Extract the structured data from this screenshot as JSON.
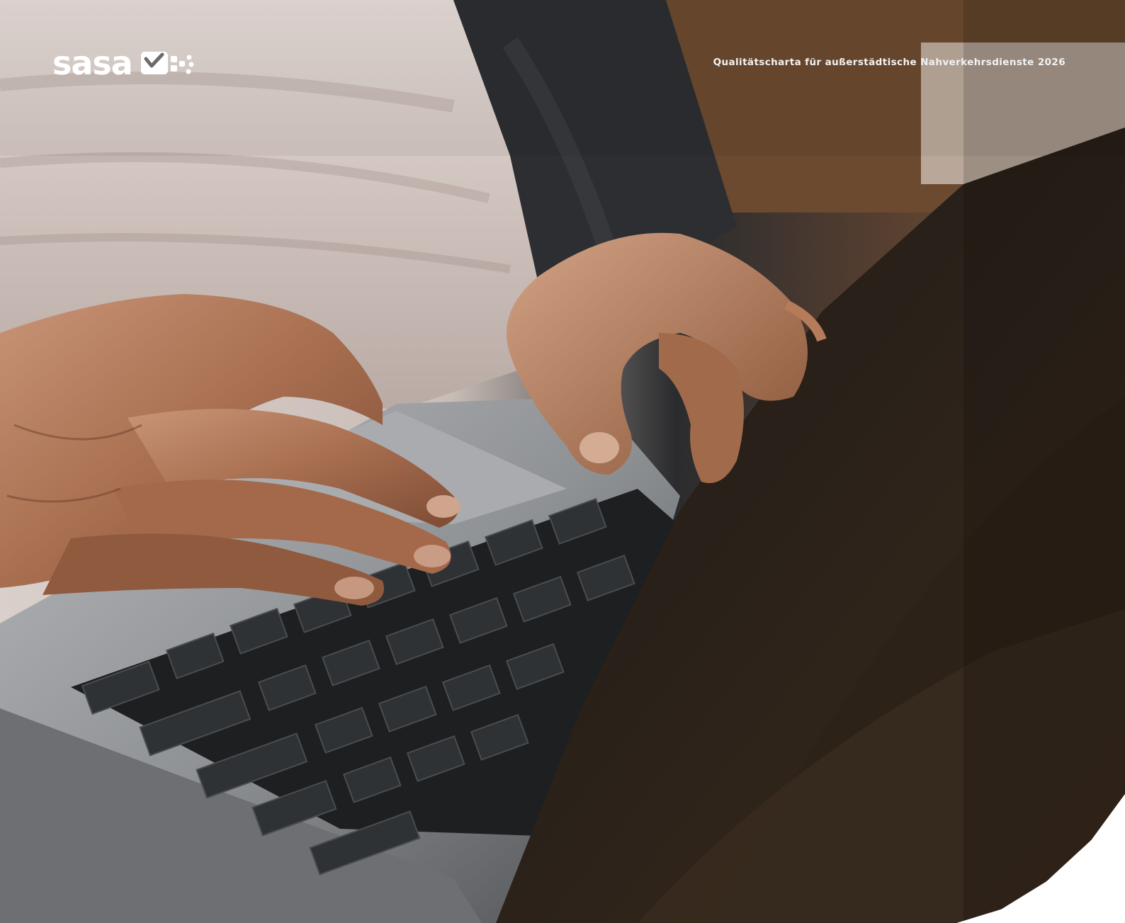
{
  "header": {
    "logo_text": "sasa",
    "logo_mark": "sasa-mark-icon",
    "title": "Qualitätscharta für außerstädtische Nahverkehrsdienste 2026"
  },
  "photo": {
    "subject": "hands typing on laptop keyboard"
  },
  "colors": {
    "text": "#ffffff",
    "background": "#ffffff"
  }
}
